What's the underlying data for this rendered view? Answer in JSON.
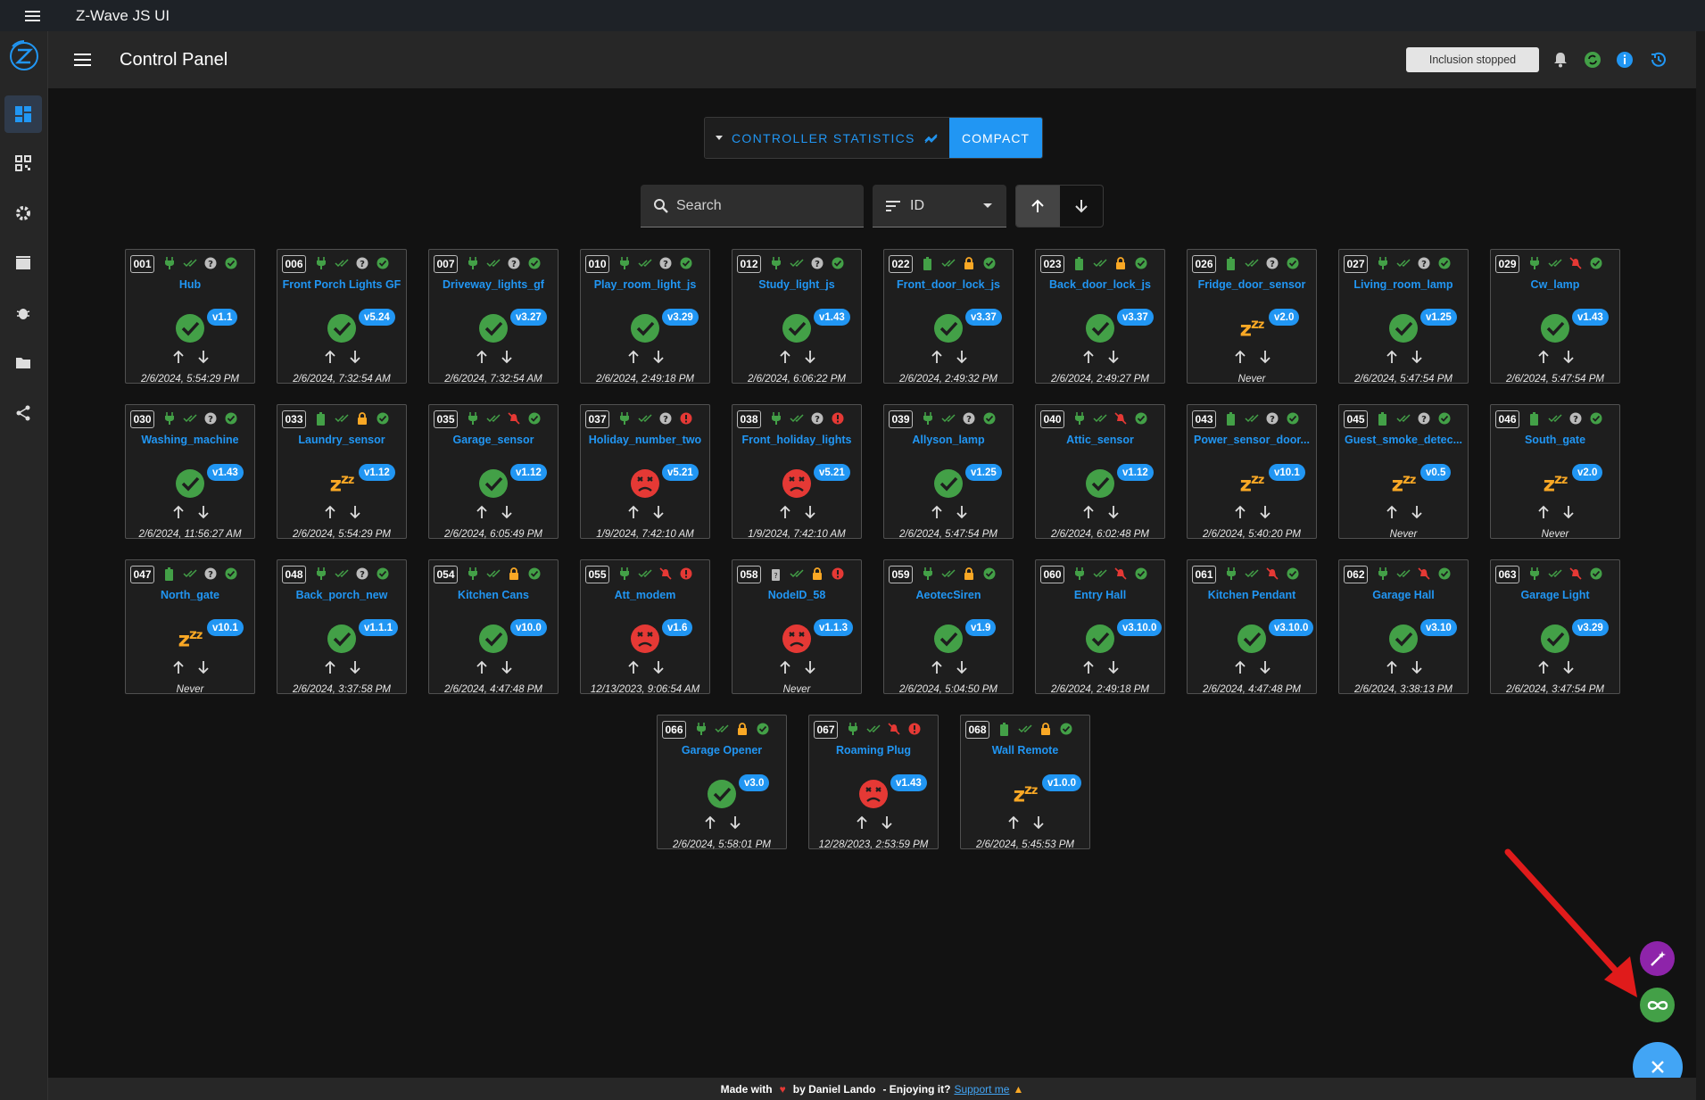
{
  "os": {
    "title": "Z-Wave JS UI"
  },
  "topbar": {
    "title": "Control Panel",
    "inclusion_status": "Inclusion stopped"
  },
  "controls": {
    "controller_statistics_label": "CONTROLLER STATISTICS",
    "compact_label": "COMPACT",
    "search_placeholder": "Search",
    "sort_field": "ID"
  },
  "colors": {
    "accent": "#2196f3",
    "ok": "#43a047",
    "error": "#e53935",
    "warning": "#f9a825",
    "wand": "#8e24aa"
  },
  "nodes": [
    {
      "id": "001",
      "name": "Hub",
      "power": "plug",
      "sec": "unknown",
      "status": "ok",
      "version": "v1.1",
      "last": "2/6/2024, 5:54:29 PM"
    },
    {
      "id": "006",
      "name": "Front Porch Lights GF",
      "power": "plug",
      "sec": "unknown",
      "status": "ok",
      "version": "v5.24",
      "last": "2/6/2024, 7:32:54 AM"
    },
    {
      "id": "007",
      "name": "Driveway_lights_gf",
      "power": "plug",
      "sec": "unknown",
      "status": "ok",
      "version": "v3.27",
      "last": "2/6/2024, 7:32:54 AM"
    },
    {
      "id": "010",
      "name": "Play_room_light_js",
      "power": "plug",
      "sec": "unknown",
      "status": "ok",
      "version": "v3.29",
      "last": "2/6/2024, 2:49:18 PM"
    },
    {
      "id": "012",
      "name": "Study_light_js",
      "power": "plug",
      "sec": "unknown",
      "status": "ok",
      "version": "v1.43",
      "last": "2/6/2024, 6:06:22 PM"
    },
    {
      "id": "022",
      "name": "Front_door_lock_js",
      "power": "battery",
      "sec": "lock",
      "status": "ok",
      "version": "v3.37",
      "last": "2/6/2024, 2:49:32 PM"
    },
    {
      "id": "023",
      "name": "Back_door_lock_js",
      "power": "battery",
      "sec": "lock",
      "status": "ok",
      "version": "v3.37",
      "last": "2/6/2024, 2:49:27 PM"
    },
    {
      "id": "026",
      "name": "Fridge_door_sensor",
      "power": "battery",
      "sec": "unknown",
      "status": "sleep",
      "version": "v2.0",
      "last": "Never"
    },
    {
      "id": "027",
      "name": "Living_room_lamp",
      "power": "plug",
      "sec": "unknown",
      "status": "ok",
      "version": "v1.25",
      "last": "2/6/2024, 5:47:54 PM"
    },
    {
      "id": "029",
      "name": "Cw_lamp",
      "power": "plug",
      "sec": "insecure",
      "status": "ok",
      "version": "v1.43",
      "last": "2/6/2024, 5:47:54 PM"
    },
    {
      "id": "030",
      "name": "Washing_machine",
      "power": "plug",
      "sec": "unknown",
      "status": "ok",
      "version": "v1.43",
      "last": "2/6/2024, 11:56:27 AM"
    },
    {
      "id": "033",
      "name": "Laundry_sensor",
      "power": "battery",
      "sec": "lock",
      "status": "sleep",
      "version": "v1.12",
      "last": "2/6/2024, 5:54:29 PM"
    },
    {
      "id": "035",
      "name": "Garage_sensor",
      "power": "plug",
      "sec": "insecure",
      "status": "ok",
      "version": "v1.12",
      "last": "2/6/2024, 6:05:49 PM"
    },
    {
      "id": "037",
      "name": "Holiday_number_two",
      "power": "plug",
      "sec": "unknown",
      "status": "dead",
      "version": "v5.21",
      "last": "1/9/2024, 7:42:10 AM",
      "err": true
    },
    {
      "id": "038",
      "name": "Front_holiday_lights",
      "power": "plug",
      "sec": "unknown",
      "status": "dead",
      "version": "v5.21",
      "last": "1/9/2024, 7:42:10 AM",
      "err": true
    },
    {
      "id": "039",
      "name": "Allyson_lamp",
      "power": "plug",
      "sec": "unknown",
      "status": "ok",
      "version": "v1.25",
      "last": "2/6/2024, 5:47:54 PM"
    },
    {
      "id": "040",
      "name": "Attic_sensor",
      "power": "plug",
      "sec": "insecure",
      "status": "ok",
      "version": "v1.12",
      "last": "2/6/2024, 6:02:48 PM"
    },
    {
      "id": "043",
      "name": "Power_sensor_door...",
      "power": "battery",
      "sec": "unknown",
      "status": "sleep",
      "version": "v10.1",
      "last": "2/6/2024, 5:40:20 PM"
    },
    {
      "id": "045",
      "name": "Guest_smoke_detec...",
      "power": "battery",
      "sec": "unknown",
      "status": "sleep",
      "version": "v0.5",
      "last": "Never"
    },
    {
      "id": "046",
      "name": "South_gate",
      "power": "battery",
      "sec": "unknown",
      "status": "sleep",
      "version": "v2.0",
      "last": "Never"
    },
    {
      "id": "047",
      "name": "North_gate",
      "power": "battery",
      "sec": "unknown",
      "status": "sleep",
      "version": "v10.1",
      "last": "Never"
    },
    {
      "id": "048",
      "name": "Back_porch_new",
      "power": "plug",
      "sec": "unknown",
      "status": "ok",
      "version": "v1.1.1",
      "last": "2/6/2024, 3:37:58 PM"
    },
    {
      "id": "054",
      "name": "Kitchen Cans",
      "power": "plug",
      "sec": "lock",
      "status": "ok",
      "version": "v10.0",
      "last": "2/6/2024, 4:47:48 PM"
    },
    {
      "id": "055",
      "name": "Att_modem",
      "power": "plug",
      "sec": "insecure",
      "status": "dead",
      "version": "v1.6",
      "last": "12/13/2023, 9:06:54 AM",
      "err": true
    },
    {
      "id": "058",
      "name": "NodeID_58",
      "power": "unknown",
      "sec": "lock",
      "status": "dead",
      "version": "v1.1.3",
      "last": "Never",
      "err": true
    },
    {
      "id": "059",
      "name": "AeotecSiren",
      "power": "plug",
      "sec": "lock",
      "status": "ok",
      "version": "v1.9",
      "last": "2/6/2024, 5:04:50 PM"
    },
    {
      "id": "060",
      "name": "Entry Hall",
      "power": "plug",
      "sec": "insecure",
      "status": "ok",
      "version": "v3.10.0",
      "last": "2/6/2024, 2:49:18 PM"
    },
    {
      "id": "061",
      "name": "Kitchen Pendant",
      "power": "plug",
      "sec": "insecure",
      "status": "ok",
      "version": "v3.10.0",
      "last": "2/6/2024, 4:47:48 PM"
    },
    {
      "id": "062",
      "name": "Garage Hall",
      "power": "plug",
      "sec": "insecure",
      "status": "ok",
      "version": "v3.10",
      "last": "2/6/2024, 3:38:13 PM"
    },
    {
      "id": "063",
      "name": "Garage Light",
      "power": "plug",
      "sec": "insecure",
      "status": "ok",
      "version": "v3.29",
      "last": "2/6/2024, 3:47:54 PM"
    },
    {
      "id": "066",
      "name": "Garage Opener",
      "power": "plug",
      "sec": "lock",
      "status": "ok",
      "version": "v3.0",
      "last": "2/6/2024, 5:58:01 PM"
    },
    {
      "id": "067",
      "name": "Roaming Plug",
      "power": "plug",
      "sec": "insecure",
      "status": "dead",
      "version": "v1.43",
      "last": "12/28/2023, 2:53:59 PM",
      "err": true
    },
    {
      "id": "068",
      "name": "Wall Remote",
      "power": "battery",
      "sec": "lock",
      "status": "sleep",
      "version": "v1.0.0",
      "last": "2/6/2024, 5:45:53 PM"
    }
  ],
  "footer": {
    "made_with": "Made with",
    "by": "by Daniel Lando",
    "enjoying": "- Enjoying it?",
    "support": "Support me"
  }
}
